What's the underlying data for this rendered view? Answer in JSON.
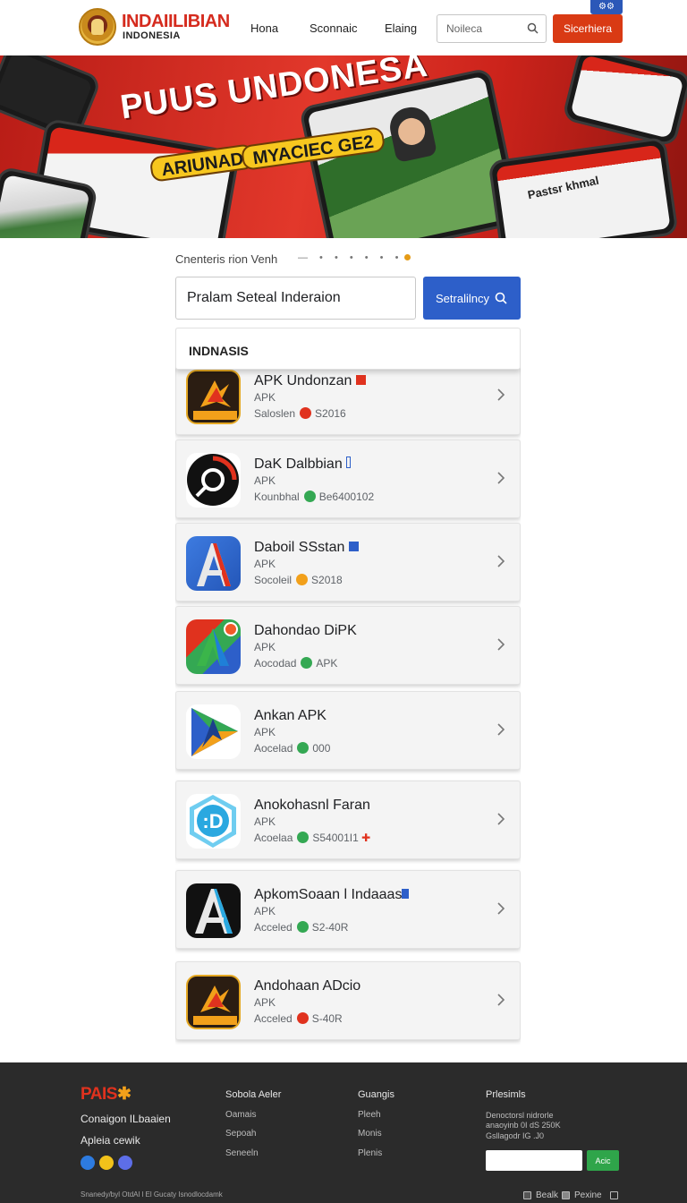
{
  "header": {
    "badge": "⚙⚙",
    "logo_title": "INDAIILIBIAN",
    "logo_sub": "INDONESIA",
    "nav": [
      "Hona",
      "Sconnaic",
      "Elaing"
    ],
    "search_placeholder": "Noileca",
    "cta": "Sicerhiera"
  },
  "hero": {
    "title": "PUUS UNDONESA",
    "pill_left": "ARIUNAD",
    "pill_right": "MYACIEC GE2",
    "phone_text": "Pastsr khmal"
  },
  "breadcrumb": "Cnenteris rion Venh",
  "search": {
    "value": "Pralam Seteal Inderaion",
    "button": "Setralilncy"
  },
  "section_title": "INDNASIS",
  "apps": [
    {
      "name": "APK Undonzan",
      "type": "APK",
      "meta_label": "Saloslen",
      "meta_value": "S2016",
      "meta_color": "#e0321e"
    },
    {
      "name": "DaK Dalbbian",
      "type": "APK",
      "meta_label": "Kounbhal",
      "meta_value": "Be6400102",
      "meta_color": "#34a853"
    },
    {
      "name": "Daboil SSstan",
      "type": "APK",
      "meta_label": "Socoleil",
      "meta_value": "S2018",
      "meta_color": "#f2a01a"
    },
    {
      "name": "Dahondao DiPK",
      "type": "APK",
      "meta_label": "Aocodad",
      "meta_value": "APK",
      "meta_color": "#34a853"
    },
    {
      "name": "Ankan APK",
      "type": "APK",
      "meta_label": "Aocelad",
      "meta_value": "000",
      "meta_color": "#34a853"
    },
    {
      "name": "Anokohasnl Faran",
      "type": "APK",
      "meta_label": "Acoelaa",
      "meta_value": "S54001I1",
      "meta_color": "#34a853"
    },
    {
      "name": "ApkomSoaan l Indaaas",
      "type": "APK",
      "meta_label": "Acceled",
      "meta_value": "S2-40R",
      "meta_color": "#34a853"
    },
    {
      "name": "Andohaan ADcio",
      "type": "APK",
      "meta_label": "Acceled",
      "meta_value": "S-40R",
      "meta_color": "#e0321e"
    }
  ],
  "footer": {
    "brand": "PAIS",
    "line1": "Conaigon ILbaaien",
    "line2": "Apleia cewik",
    "col1": {
      "title": "Sobola Aeler",
      "links": [
        "Oamais",
        "Sepoah",
        "Seneeln"
      ]
    },
    "col2": {
      "title": "Guangis",
      "links": [
        "Pleeh",
        "Monis",
        "Plenis"
      ]
    },
    "col3": {
      "title": "Prlesimls",
      "small1": "Denoctorsl nidrorle",
      "small2": "anaoyinb 0I dS 250K",
      "small3": "Gsllagodr IG .J0",
      "button": "Acic"
    },
    "copyright": "Snanedy/byl OtdAl l El Gucaty Isnodlocdamk",
    "bottom_links": [
      "Bealk",
      "Pexine"
    ]
  }
}
